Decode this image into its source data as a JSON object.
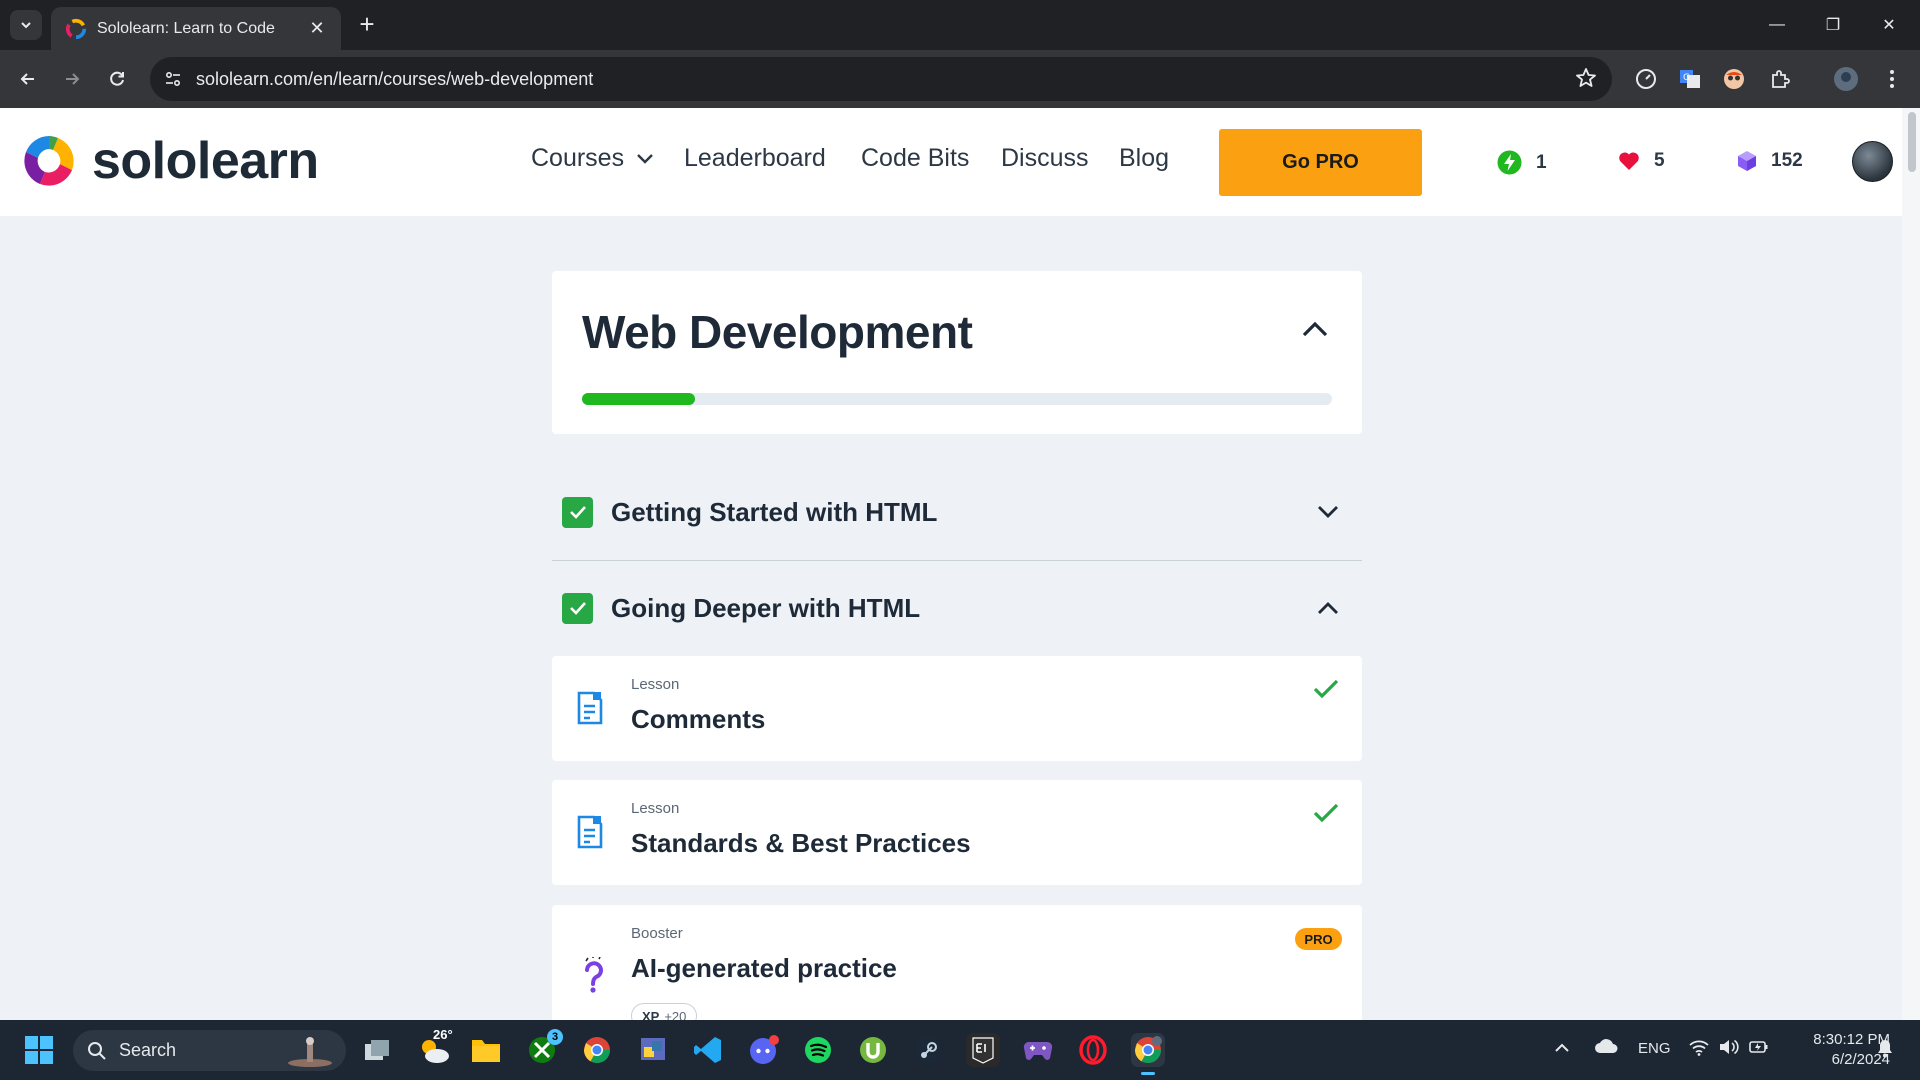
{
  "browser": {
    "tab_title": "Sololearn: Learn to Code",
    "url": "sololearn.com/en/learn/courses/web-development"
  },
  "header": {
    "brand": "sololearn",
    "nav": {
      "courses": "Courses",
      "leaderboard": "Leaderboard",
      "code_bits": "Code Bits",
      "discuss": "Discuss",
      "blog": "Blog"
    },
    "go_pro": "Go PRO",
    "streak": "1",
    "hearts": "5",
    "bits": "152"
  },
  "course": {
    "title": "Web Development",
    "progress": 0.15,
    "progress_color": "#1fb81f"
  },
  "sections": [
    {
      "title": "Getting Started with HTML",
      "completed": true,
      "expanded": false
    },
    {
      "title": "Going Deeper with HTML",
      "completed": true,
      "expanded": true
    }
  ],
  "lessons": [
    {
      "type": "Lesson",
      "name": "Comments",
      "completed": true
    },
    {
      "type": "Lesson",
      "name": "Standards & Best Practices",
      "completed": true
    },
    {
      "type": "Booster",
      "name": "AI-generated practice",
      "badge": "PRO",
      "xp_label": "XP",
      "xp_value": "+20"
    }
  ],
  "taskbar": {
    "search_label": "Search",
    "weather": "26°",
    "xbox_badge": "3",
    "lang": "ENG",
    "time": "8:30:12 PM",
    "date": "6/2/2024"
  },
  "colors": {
    "accent_orange": "#fba111",
    "success_green": "#28a745",
    "heart_red": "#e8103c",
    "bits_purple": "#8a5cf6"
  }
}
